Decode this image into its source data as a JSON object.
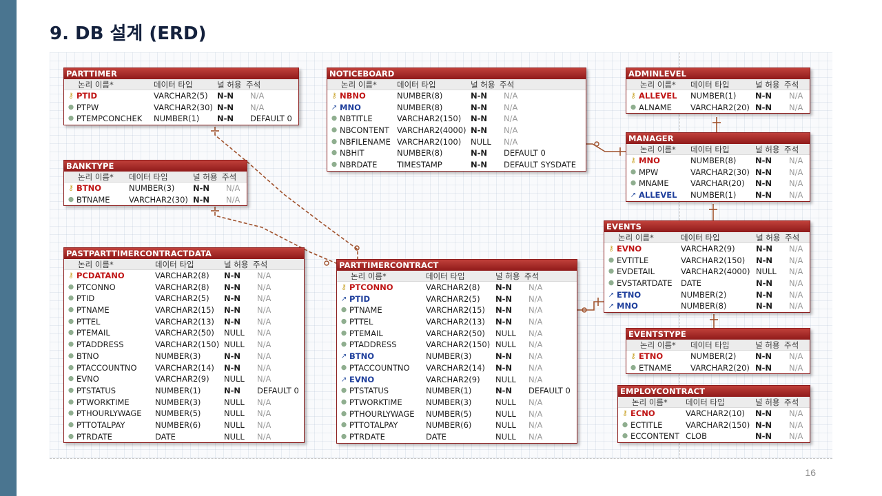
{
  "slide": {
    "title": "9. DB 설계 (ERD)",
    "page_number": "16"
  },
  "colors": {
    "accent_bar": "#4a7590",
    "entity_header": "#9e2424",
    "pk_text": "#c01515",
    "fk_text": "#1f3f9c",
    "relationship_line": "#a0522d"
  },
  "icons": {
    "pk": "key-icon",
    "fk": "foreign-key-icon",
    "col": "column-dot-icon"
  },
  "column_headers": {
    "logical": "논리 이름",
    "type": "데이터 타입",
    "null": "널 허용",
    "comment": "주석"
  },
  "entities": [
    {
      "id": "PARTTIMER",
      "title": "PARTTIMER",
      "columns": [
        {
          "name": "PTID",
          "type": "VARCHAR2(5)",
          "null": "N-N",
          "comment": "N/A",
          "key": "pk"
        },
        {
          "name": "PTPW",
          "type": "VARCHAR2(30)",
          "null": "N-N",
          "comment": "N/A",
          "key": ""
        },
        {
          "name": "PTEMPCONCHEK",
          "type": "NUMBER(1)",
          "null": "N-N",
          "comment": "DEFAULT 0",
          "key": ""
        }
      ]
    },
    {
      "id": "BANKTYPE",
      "title": "BANKTYPE",
      "columns": [
        {
          "name": "BTNO",
          "type": "NUMBER(3)",
          "null": "N-N",
          "comment": "N/A",
          "key": "pk"
        },
        {
          "name": "BTNAME",
          "type": "VARCHAR2(30)",
          "null": "N-N",
          "comment": "N/A",
          "key": ""
        }
      ]
    },
    {
      "id": "PASTPARTTIMERCONTRACTDATA",
      "title": "PASTPARTTIMERCONTRACTDATA",
      "columns": [
        {
          "name": "PCDATANO",
          "type": "VARCHAR2(8)",
          "null": "N-N",
          "comment": "N/A",
          "key": "pk"
        },
        {
          "name": "PTCONNO",
          "type": "VARCHAR2(8)",
          "null": "N-N",
          "comment": "N/A",
          "key": ""
        },
        {
          "name": "PTID",
          "type": "VARCHAR2(5)",
          "null": "N-N",
          "comment": "N/A",
          "key": ""
        },
        {
          "name": "PTNAME",
          "type": "VARCHAR2(15)",
          "null": "N-N",
          "comment": "N/A",
          "key": ""
        },
        {
          "name": "PTTEL",
          "type": "VARCHAR2(13)",
          "null": "N-N",
          "comment": "N/A",
          "key": ""
        },
        {
          "name": "PTEMAIL",
          "type": "VARCHAR2(50)",
          "null": "NULL",
          "comment": "N/A",
          "key": ""
        },
        {
          "name": "PTADDRESS",
          "type": "VARCHAR2(150)",
          "null": "NULL",
          "comment": "N/A",
          "key": ""
        },
        {
          "name": "BTNO",
          "type": "NUMBER(3)",
          "null": "N-N",
          "comment": "N/A",
          "key": ""
        },
        {
          "name": "PTACCOUNTNO",
          "type": "VARCHAR2(14)",
          "null": "N-N",
          "comment": "N/A",
          "key": ""
        },
        {
          "name": "EVNO",
          "type": "VARCHAR2(9)",
          "null": "NULL",
          "comment": "N/A",
          "key": ""
        },
        {
          "name": "PTSTATUS",
          "type": "NUMBER(1)",
          "null": "N-N",
          "comment": "DEFAULT 0",
          "key": ""
        },
        {
          "name": "PTWORKTIME",
          "type": "NUMBER(3)",
          "null": "NULL",
          "comment": "N/A",
          "key": ""
        },
        {
          "name": "PTHOURLYWAGE",
          "type": "NUMBER(5)",
          "null": "NULL",
          "comment": "N/A",
          "key": ""
        },
        {
          "name": "PTTOTALPAY",
          "type": "NUMBER(6)",
          "null": "NULL",
          "comment": "N/A",
          "key": ""
        },
        {
          "name": "PTRDATE",
          "type": "DATE",
          "null": "NULL",
          "comment": "N/A",
          "key": ""
        }
      ]
    },
    {
      "id": "NOTICEBOARD",
      "title": "NOTICEBOARD",
      "columns": [
        {
          "name": "NBNO",
          "type": "NUMBER(8)",
          "null": "N-N",
          "comment": "N/A",
          "key": "pk"
        },
        {
          "name": "MNO",
          "type": "NUMBER(8)",
          "null": "N-N",
          "comment": "N/A",
          "key": "fk"
        },
        {
          "name": "NBTITLE",
          "type": "VARCHAR2(150)",
          "null": "N-N",
          "comment": "N/A",
          "key": ""
        },
        {
          "name": "NBCONTENT",
          "type": "VARCHAR2(4000)",
          "null": "N-N",
          "comment": "N/A",
          "key": ""
        },
        {
          "name": "NBFILENAME",
          "type": "VARCHAR2(100)",
          "null": "NULL",
          "comment": "N/A",
          "key": ""
        },
        {
          "name": "NBHIT",
          "type": "NUMBER(8)",
          "null": "N-N",
          "comment": "DEFAULT 0",
          "key": ""
        },
        {
          "name": "NBRDATE",
          "type": "TIMESTAMP",
          "null": "N-N",
          "comment": "DEFAULT SYSDATE",
          "key": ""
        }
      ]
    },
    {
      "id": "PARTTIMERCONTRACT",
      "title": "PARTTIMERCONTRACT",
      "columns": [
        {
          "name": "PTCONNO",
          "type": "VARCHAR2(8)",
          "null": "N-N",
          "comment": "N/A",
          "key": "pk"
        },
        {
          "name": "PTID",
          "type": "VARCHAR2(5)",
          "null": "N-N",
          "comment": "N/A",
          "key": "fk"
        },
        {
          "name": "PTNAME",
          "type": "VARCHAR2(15)",
          "null": "N-N",
          "comment": "N/A",
          "key": ""
        },
        {
          "name": "PTTEL",
          "type": "VARCHAR2(13)",
          "null": "N-N",
          "comment": "N/A",
          "key": ""
        },
        {
          "name": "PTEMAIL",
          "type": "VARCHAR2(50)",
          "null": "NULL",
          "comment": "N/A",
          "key": ""
        },
        {
          "name": "PTADDRESS",
          "type": "VARCHAR2(150)",
          "null": "NULL",
          "comment": "N/A",
          "key": ""
        },
        {
          "name": "BTNO",
          "type": "NUMBER(3)",
          "null": "N-N",
          "comment": "N/A",
          "key": "fk"
        },
        {
          "name": "PTACCOUNTNO",
          "type": "VARCHAR2(14)",
          "null": "N-N",
          "comment": "N/A",
          "key": ""
        },
        {
          "name": "EVNO",
          "type": "VARCHAR2(9)",
          "null": "NULL",
          "comment": "N/A",
          "key": "fk"
        },
        {
          "name": "PTSTATUS",
          "type": "NUMBER(1)",
          "null": "N-N",
          "comment": "DEFAULT 0",
          "key": ""
        },
        {
          "name": "PTWORKTIME",
          "type": "NUMBER(3)",
          "null": "NULL",
          "comment": "N/A",
          "key": ""
        },
        {
          "name": "PTHOURLYWAGE",
          "type": "NUMBER(5)",
          "null": "NULL",
          "comment": "N/A",
          "key": ""
        },
        {
          "name": "PTTOTALPAY",
          "type": "NUMBER(6)",
          "null": "NULL",
          "comment": "N/A",
          "key": ""
        },
        {
          "name": "PTRDATE",
          "type": "DATE",
          "null": "NULL",
          "comment": "N/A",
          "key": ""
        }
      ]
    },
    {
      "id": "ADMINLEVEL",
      "title": "ADMINLEVEL",
      "columns": [
        {
          "name": "ALLEVEL",
          "type": "NUMBER(1)",
          "null": "N-N",
          "comment": "N/A",
          "key": "pk"
        },
        {
          "name": "ALNAME",
          "type": "VARCHAR2(20)",
          "null": "N-N",
          "comment": "N/A",
          "key": ""
        }
      ]
    },
    {
      "id": "MANAGER",
      "title": "MANAGER",
      "columns": [
        {
          "name": "MNO",
          "type": "NUMBER(8)",
          "null": "N-N",
          "comment": "N/A",
          "key": "pk"
        },
        {
          "name": "MPW",
          "type": "VARCHAR2(30)",
          "null": "N-N",
          "comment": "N/A",
          "key": ""
        },
        {
          "name": "MNAME",
          "type": "VARCHAR(20)",
          "null": "N-N",
          "comment": "N/A",
          "key": ""
        },
        {
          "name": "ALLEVEL",
          "type": "NUMBER(1)",
          "null": "N-N",
          "comment": "N/A",
          "key": "fk"
        }
      ]
    },
    {
      "id": "EVENTS",
      "title": "EVENTS",
      "columns": [
        {
          "name": "EVNO",
          "type": "VARCHAR2(9)",
          "null": "N-N",
          "comment": "N/A",
          "key": "pk"
        },
        {
          "name": "EVTITLE",
          "type": "VARCHAR2(150)",
          "null": "N-N",
          "comment": "N/A",
          "key": ""
        },
        {
          "name": "EVDETAIL",
          "type": "VARCHAR2(4000)",
          "null": "NULL",
          "comment": "N/A",
          "key": ""
        },
        {
          "name": "EVSTARTDATE",
          "type": "DATE",
          "null": "N-N",
          "comment": "N/A",
          "key": ""
        },
        {
          "name": "ETNO",
          "type": "NUMBER(2)",
          "null": "N-N",
          "comment": "N/A",
          "key": "fk"
        },
        {
          "name": "MNO",
          "type": "NUMBER(8)",
          "null": "N-N",
          "comment": "N/A",
          "key": "fk"
        }
      ]
    },
    {
      "id": "EVENTSTYPE",
      "title": "EVENTSTYPE",
      "columns": [
        {
          "name": "ETNO",
          "type": "NUMBER(2)",
          "null": "N-N",
          "comment": "N/A",
          "key": "pk"
        },
        {
          "name": "ETNAME",
          "type": "VARCHAR2(20)",
          "null": "N-N",
          "comment": "N/A",
          "key": ""
        }
      ]
    },
    {
      "id": "EMPLOYCONTRACT",
      "title": "EMPLOYCONTRACT",
      "columns": [
        {
          "name": "ECNO",
          "type": "VARCHAR2(10)",
          "null": "N-N",
          "comment": "N/A",
          "key": "pk"
        },
        {
          "name": "ECTITLE",
          "type": "VARCHAR2(150)",
          "null": "N-N",
          "comment": "N/A",
          "key": ""
        },
        {
          "name": "ECCONTENT",
          "type": "CLOB",
          "null": "N-N",
          "comment": "N/A",
          "key": ""
        }
      ]
    }
  ]
}
